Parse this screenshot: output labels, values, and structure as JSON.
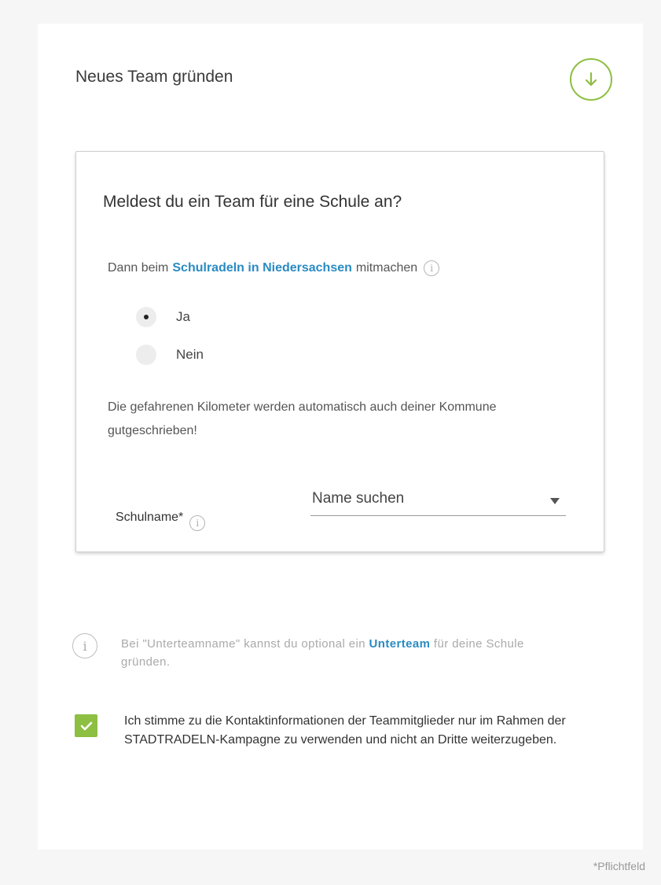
{
  "header": {
    "title": "Neues Team gründen"
  },
  "school_panel": {
    "question": "Meldest du ein Team für eine Schule an?",
    "intro_prefix": "Dann beim",
    "intro_link": "Schulradeln in Niedersachsen",
    "intro_suffix": "mitmachen",
    "options": [
      {
        "label": "Ja",
        "selected": true
      },
      {
        "label": "Nein",
        "selected": false
      }
    ],
    "note": "Die gefahrenen Kilometer werden automatisch auch deiner Kommune gutgeschrieben!",
    "school_field": {
      "label": "Schulname*",
      "placeholder": "Name suchen"
    }
  },
  "hint": {
    "text_prefix": "Bei \"Unterteamname\" kannst du optional ein",
    "link": "Unterteam",
    "text_suffix": "für deine Schule gründen."
  },
  "consent": {
    "checked": true,
    "text": "Ich stimme zu die Kontaktinformationen der Teammitglieder nur im Rahmen der STADTRADELN-Kampagne zu verwenden und nicht an Dritte weiterzugeben."
  },
  "footer": {
    "required_note": "*Pflichtfeld"
  },
  "colors": {
    "accent_green": "#8dbf42",
    "link_blue": "#2a8bc2"
  },
  "icons": {
    "download": "arrow-down-circle-icon",
    "info": "info-icon",
    "check": "checkmark-icon",
    "dropdown": "caret-down-icon"
  }
}
